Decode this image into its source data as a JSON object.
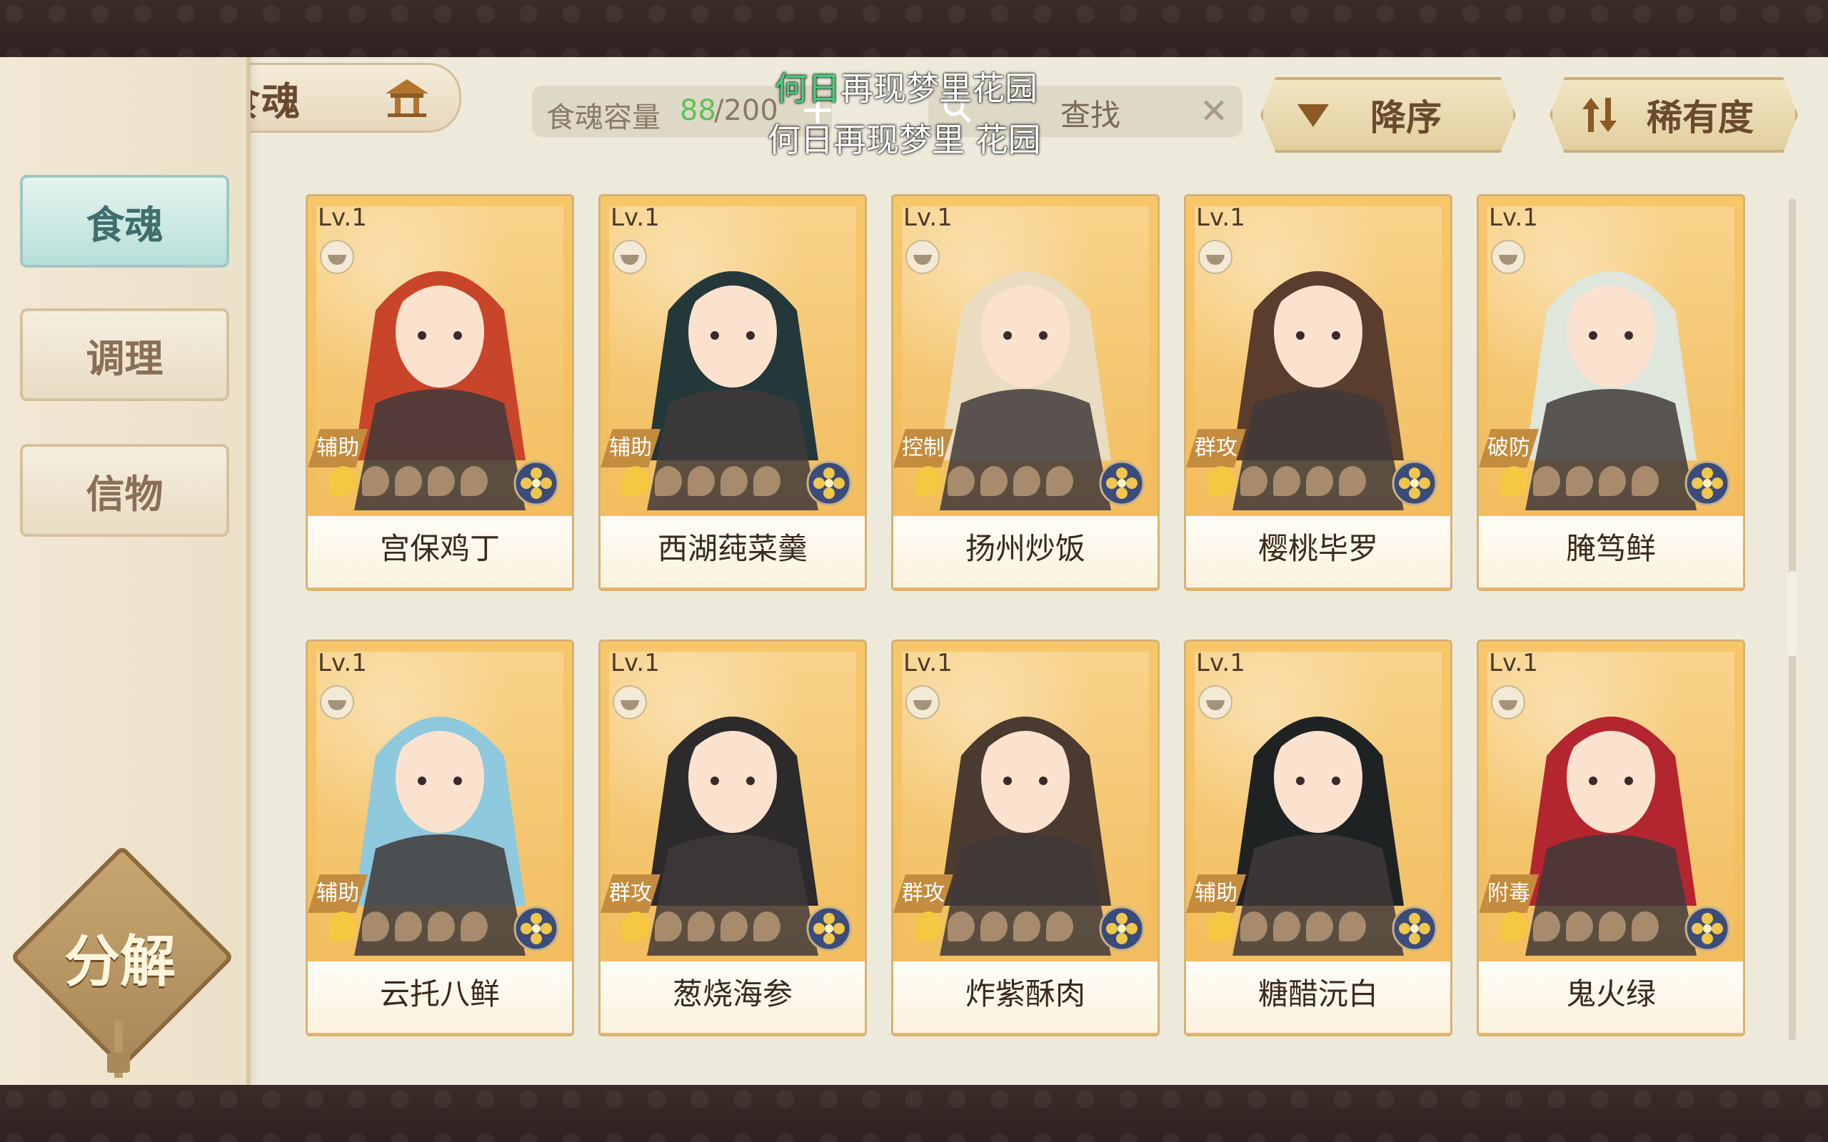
{
  "header": {
    "title": "食魂",
    "capacity_label": "食魂容量",
    "capacity_used": "88",
    "capacity_max": "/200",
    "search_placeholder": "查找",
    "sort_order": "降序",
    "sort_key": "稀有度"
  },
  "subtitles": {
    "line1_highlight": "何日",
    "line1_rest": "再现梦里花园",
    "line2": "何日再现梦里  花园"
  },
  "sidebar": {
    "items": [
      {
        "label": "食魂",
        "active": true
      },
      {
        "label": "调理",
        "active": false
      },
      {
        "label": "信物",
        "active": false
      }
    ],
    "decompose_label": "分解"
  },
  "cards": [
    {
      "level": "Lv.1",
      "role": "辅助",
      "name": "宫保鸡丁",
      "stars": 1,
      "hair": "#c8452a"
    },
    {
      "level": "Lv.1",
      "role": "辅助",
      "name": "西湖莼菜羹",
      "stars": 1,
      "hair": "#24383a"
    },
    {
      "level": "Lv.1",
      "role": "控制",
      "name": "扬州炒饭",
      "stars": 1,
      "hair": "#e9dcc0"
    },
    {
      "level": "Lv.1",
      "role": "群攻",
      "name": "樱桃毕罗",
      "stars": 1,
      "hair": "#5a3d2c"
    },
    {
      "level": "Lv.1",
      "role": "破防",
      "name": "腌笃鲜",
      "stars": 1,
      "hair": "#dfe6dc"
    },
    {
      "level": "Lv.1",
      "role": "辅助",
      "name": "云托八鲜",
      "stars": 1,
      "hair": "#8ec9dd"
    },
    {
      "level": "Lv.1",
      "role": "群攻",
      "name": "葱烧海参",
      "stars": 1,
      "hair": "#2c2a2a"
    },
    {
      "level": "Lv.1",
      "role": "群攻",
      "name": "炸紫酥肉",
      "stars": 1,
      "hair": "#4a3a30"
    },
    {
      "level": "Lv.1",
      "role": "辅助",
      "name": "糖醋沅白",
      "stars": 1,
      "hair": "#1e2222"
    },
    {
      "level": "Lv.1",
      "role": "附毒",
      "name": "鬼火绿",
      "stars": 1,
      "hair": "#b32630"
    }
  ],
  "colors": {
    "panel_bg": "#eeeadb",
    "card_gold": "#f2b95a",
    "capacity_green": "#5cc25a",
    "active_tab": "#b7dfd9"
  },
  "icons": {
    "back": "back-arrow-icon",
    "home": "pavilion-icon",
    "search": "search-icon",
    "clear": "close-icon",
    "sort_order": "triangle-down-icon",
    "sort_key": "swap-arrows-icon",
    "bowl": "bowl-icon",
    "element": "flower-element-icon",
    "star": "flame-star-icon"
  }
}
